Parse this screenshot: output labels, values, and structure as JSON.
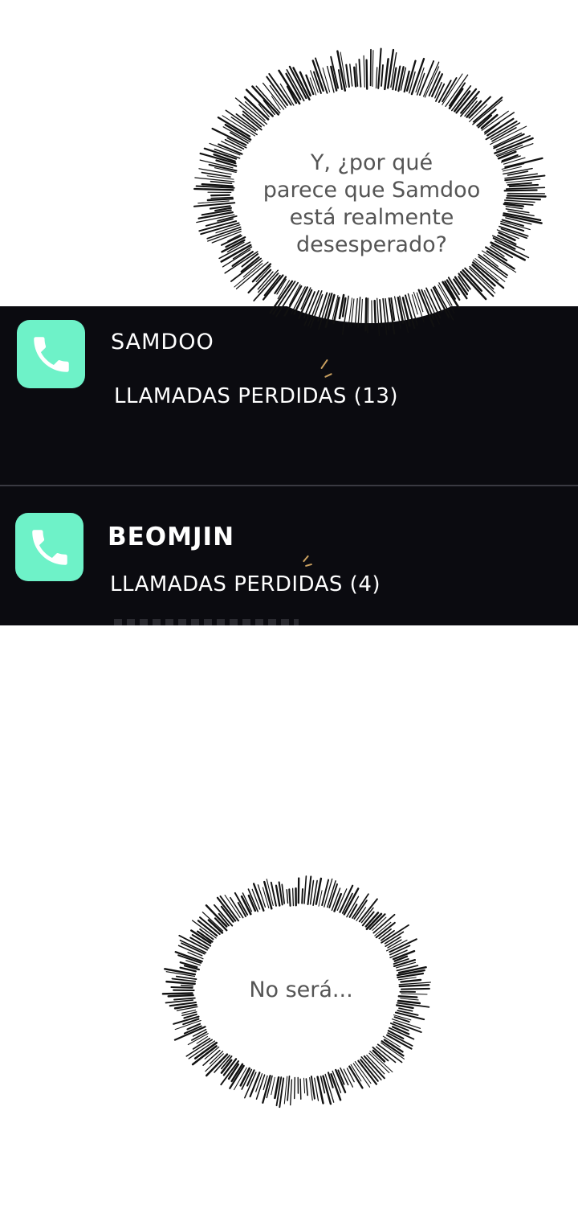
{
  "bubble_top": {
    "lines": [
      "Y, ¿por qué",
      "parece que Samdoo",
      "está realmente",
      "desesperado?"
    ]
  },
  "notifications": [
    {
      "icon": "phone-icon",
      "caller": "SAMDOO",
      "status": "LLAMADAS PERDIDAS (13)"
    },
    {
      "icon": "phone-icon",
      "caller": "BEOMJIN",
      "status": "LLAMADAS PERDIDAS (4)"
    }
  ],
  "bubble_bottom": {
    "text": "No será..."
  },
  "colors": {
    "panel_background": "#0b0b10",
    "app_icon": "#6ef2c8",
    "notification_text": "#ffffff",
    "bubble_text": "#555555",
    "burst_lines": "#111111"
  }
}
